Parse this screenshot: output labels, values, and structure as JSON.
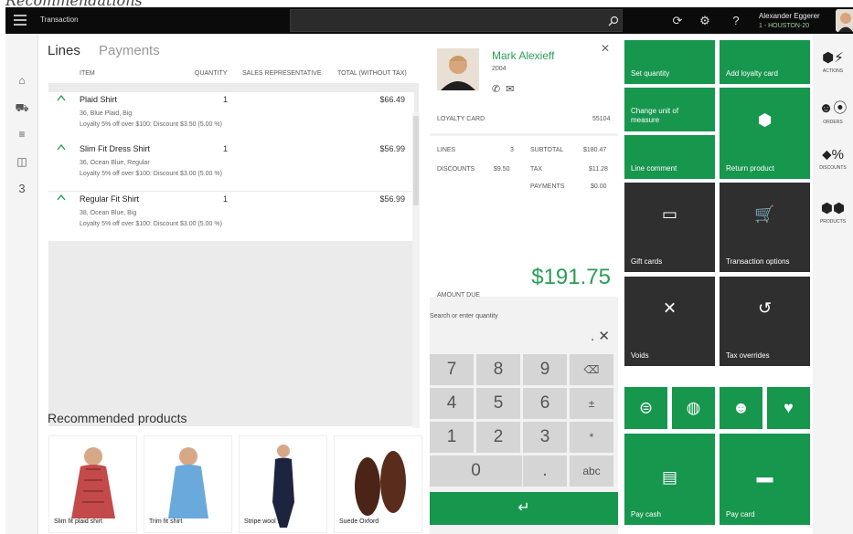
{
  "cut_caption": "Recommendations",
  "topbar": {
    "title": "Transaction",
    "user_name": "Alexander Eggerer",
    "user_store": "1 - HOUSTON-20",
    "icons": [
      "menu-icon",
      "search-icon",
      "refresh-icon",
      "settings-icon",
      "help-icon"
    ]
  },
  "leftnav": {
    "cart_count": "3",
    "icons": [
      "home-icon",
      "products-icon",
      "list-icon",
      "bag-icon"
    ]
  },
  "lines": {
    "tabs": [
      "Lines",
      "Payments"
    ],
    "columns": [
      "ITEM",
      "QUANTITY",
      "SALES REPRESENTATIVE",
      "TOTAL (WITHOUT TAX)"
    ],
    "items": [
      {
        "name": "Plaid Shirt",
        "qty": "1",
        "total": "$66.49",
        "variant": "36, Blue Plaid, Big",
        "discount": "Loyalty 5% off over $100: Discount $3.50 (5.00 %)"
      },
      {
        "name": "Slim Fit Dress Shirt",
        "qty": "1",
        "total": "$56.99",
        "variant": "36, Ocean Blue, Regular",
        "discount": "Loyalty 5% off over $100: Discount $3.00 (5.00 %)"
      },
      {
        "name": "Regular Fit Shirt",
        "qty": "1",
        "total": "$56.99",
        "variant": "38, Ocean Blue, Big",
        "discount": "Loyalty 5% off over $100: Discount $3.00 (5.00 %)"
      }
    ]
  },
  "recommended": {
    "title": "Recommended products",
    "products": [
      "Slim fit plaid shirt",
      "Trim fit shirt",
      "Stripe wool suit",
      "Suede Oxford"
    ]
  },
  "customer": {
    "name": "Mark Alexieff",
    "year": "2004",
    "loyalty_label": "LOYALTY CARD",
    "loyalty_value": "55104",
    "lines_label": "LINES",
    "lines_value": "3",
    "subtotal_label": "SUBTOTAL",
    "subtotal_value": "$180.47",
    "discounts_label": "DISCOUNTS",
    "discounts_value": "$9.50",
    "tax_label": "TAX",
    "tax_value": "$11.28",
    "payments_label": "PAYMENTS",
    "payments_value": "$0.00",
    "amount_due_label": "AMOUNT DUE",
    "amount_due_value": "$191.75"
  },
  "numpad": {
    "search_placeholder": "Search or enter quantity",
    "dot_x": ". ✕",
    "keys": [
      "7",
      "8",
      "9",
      "⌫",
      "4",
      "5",
      "6",
      "±",
      "1",
      "2",
      "3",
      "*",
      "0",
      ".",
      "abc"
    ],
    "enter": "↵"
  },
  "tiles": {
    "set_quantity": "Set quantity",
    "add_loyalty_card": "Add loyalty card",
    "change_unit": "Change unit of measure",
    "return_product": "Return product",
    "line_comment": "Line comment",
    "gift_cards": "Gift cards",
    "transaction_options": "Transaction options",
    "voids": "Voids",
    "tax_overrides": "Tax overrides",
    "pay_cash": "Pay cash",
    "pay_card": "Pay card"
  },
  "rightbar": {
    "actions": "ACTIONS",
    "orders": "ORDERS",
    "discounts": "DISCOUNTS",
    "products": "PRODUCTS"
  },
  "colors": {
    "accent_green": "#17964e",
    "dark_tile": "#2f2f2f",
    "topbar": "#0b0b0b"
  }
}
